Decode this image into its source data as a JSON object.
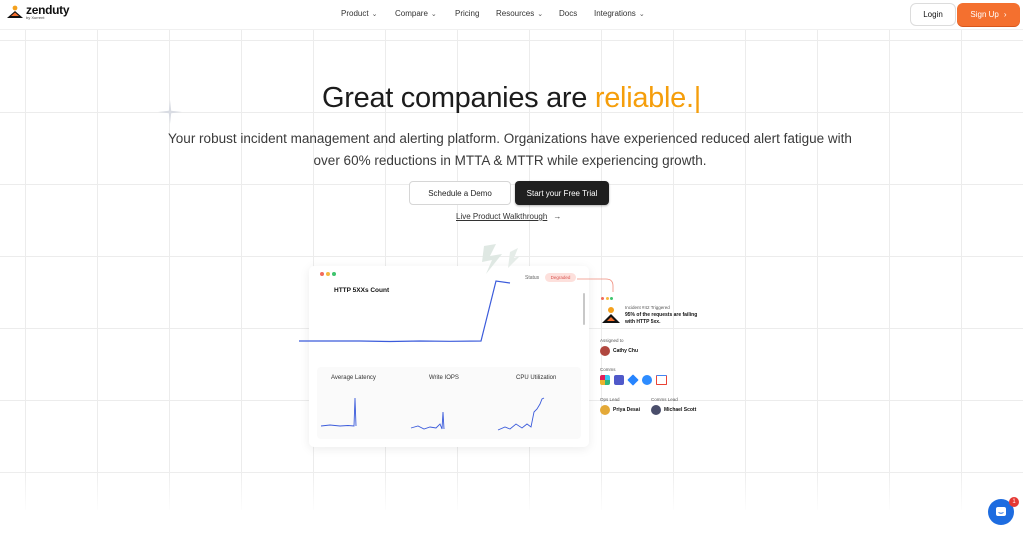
{
  "brand": {
    "name": "zenduty",
    "sub": "by Xurrent"
  },
  "nav": {
    "items": [
      {
        "label": "Product",
        "has_dropdown": true
      },
      {
        "label": "Compare",
        "has_dropdown": true
      },
      {
        "label": "Pricing",
        "has_dropdown": false
      },
      {
        "label": "Resources",
        "has_dropdown": true
      },
      {
        "label": "Docs",
        "has_dropdown": false
      },
      {
        "label": "Integrations",
        "has_dropdown": true
      }
    ],
    "login": "Login",
    "signup": "Sign Up",
    "signup_chevron": "›"
  },
  "hero": {
    "title_main": "Great companies are ",
    "title_accent": "reliable.|",
    "subtitle_line1": "Your robust incident management and alerting platform. Organizations have experienced reduced alert fatigue with",
    "subtitle_line2": "over 60% reductions in MTTA & MTTR while experiencing growth.",
    "cta_demo": "Schedule a Demo",
    "cta_trial": "Start your Free Trial",
    "walkthrough": "Live Product Walkthrough",
    "walkthrough_arrow": "→"
  },
  "dashboard": {
    "title": "HTTP 5XXs Count",
    "status_label": "Status",
    "status_value": "Degraded",
    "metrics": [
      "Average Latency",
      "Write IOPS",
      "CPU Utilization"
    ]
  },
  "incident": {
    "header": "Incident #42 Triggered",
    "message_line1": "95% of the requests are failing",
    "message_line2": "with HTTP 5xx.",
    "assigned_label": "Assigned to",
    "assignee": "Cathy Chu",
    "comms_label": "Comms",
    "ops_lead_label": "Ops Lead",
    "ops_lead": "Priya Desai",
    "comms_lead_label": "Comms Lead",
    "comms_lead": "Michael Scott"
  },
  "chat": {
    "badge_count": "1"
  },
  "colors": {
    "accent_orange": "#f4702f",
    "title_accent": "#f59e0b",
    "chart_blue": "#3b5bdb",
    "degraded_red": "#d9534f"
  }
}
